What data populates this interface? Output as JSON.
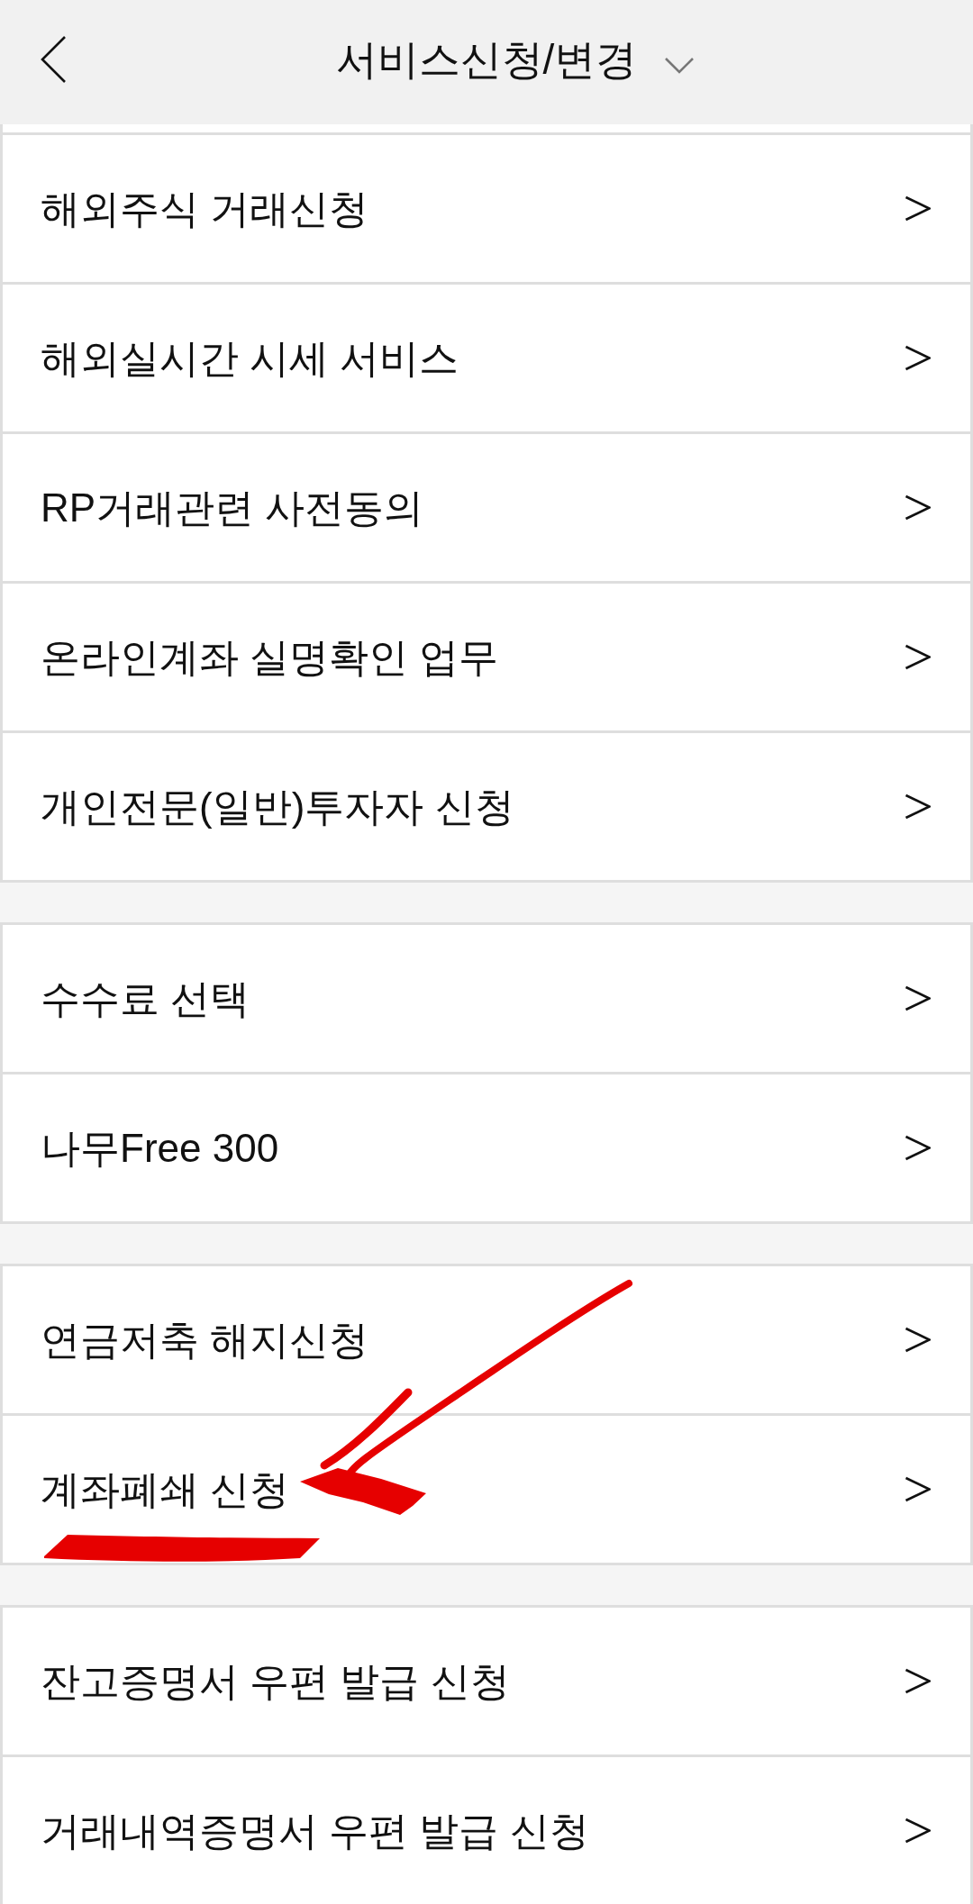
{
  "header": {
    "title": "서비스신청/변경"
  },
  "groups": [
    {
      "items": [
        {
          "label": "해외주식 거래신청",
          "annotated": false
        },
        {
          "label": "해외실시간 시세 서비스",
          "annotated": false
        },
        {
          "label": "RP거래관련 사전동의",
          "annotated": false
        },
        {
          "label": "온라인계좌 실명확인 업무",
          "annotated": false
        },
        {
          "label": "개인전문(일반)투자자 신청",
          "annotated": false
        }
      ]
    },
    {
      "items": [
        {
          "label": "수수료 선택",
          "annotated": false
        },
        {
          "label": "나무Free 300",
          "annotated": false
        }
      ]
    },
    {
      "items": [
        {
          "label": "연금저축 해지신청",
          "annotated": false
        },
        {
          "label": "계좌폐쇄 신청",
          "annotated": true
        }
      ]
    },
    {
      "items": [
        {
          "label": "잔고증명서 우편 발급 신청",
          "annotated": false
        },
        {
          "label": "거래내역증명서 우편 발급 신청",
          "annotated": false
        }
      ]
    }
  ]
}
